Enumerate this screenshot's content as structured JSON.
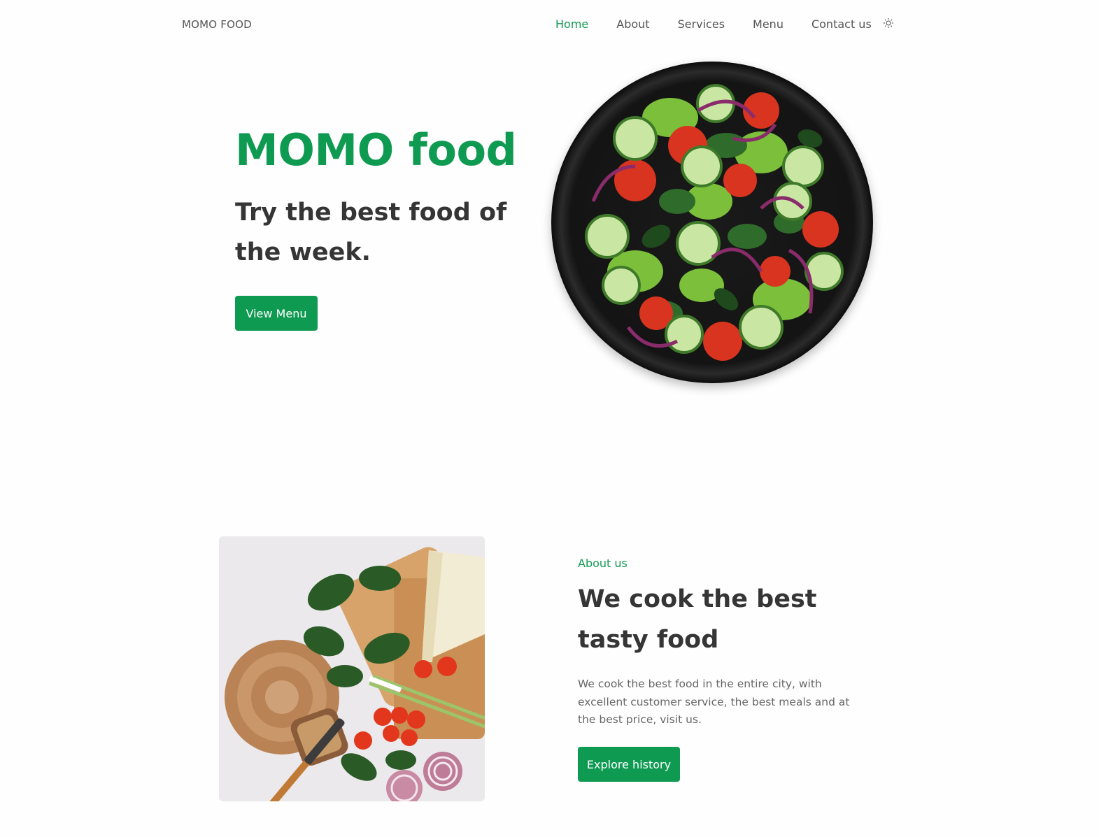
{
  "header": {
    "brand": "MOMO FOOD",
    "nav": [
      {
        "label": "Home",
        "active": true
      },
      {
        "label": "About",
        "active": false
      },
      {
        "label": "Services",
        "active": false
      },
      {
        "label": "Menu",
        "active": false
      },
      {
        "label": "Contact us",
        "active": false
      }
    ],
    "theme_icon": "sun-icon"
  },
  "hero": {
    "title": "MOMO food",
    "subtitle": "Try the best food of the week.",
    "button_label": "View Menu",
    "image": "salad-plate-image"
  },
  "about": {
    "image": "ingredients-image",
    "kicker": "About us",
    "title": "We cook the best tasty food",
    "text": "We cook the best food in the entire city, with excellent customer service, the best meals and at the best price, visit us.",
    "button_label": "Explore history"
  },
  "colors": {
    "accent": "#0f9a52",
    "heading": "#353535",
    "body_text": "#666666",
    "background": "#fefefe"
  }
}
